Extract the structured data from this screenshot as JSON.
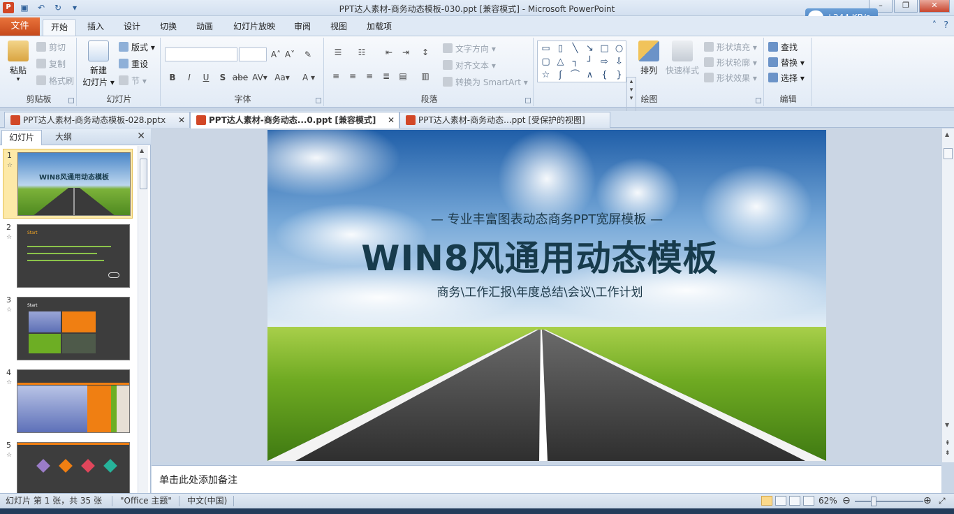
{
  "window": {
    "title": "PPT达人素材-商务动态模板-030.ppt [兼容模式]  -  Microsoft PowerPoint",
    "app_icon": "P"
  },
  "speed_widget": {
    "text": "↓244 KB/s"
  },
  "ribbon_tabs": [
    "文件",
    "开始",
    "插入",
    "设计",
    "切换",
    "动画",
    "幻灯片放映",
    "审阅",
    "视图",
    "加载项"
  ],
  "ribbon": {
    "clipboard": {
      "paste": "粘贴",
      "cut": "剪切",
      "copy": "复制",
      "format_painter": "格式刷",
      "label": "剪贴板"
    },
    "slides": {
      "new_slide_line1": "新建",
      "new_slide_line2": "幻灯片 ▾",
      "layout": "版式 ▾",
      "reset": "重设",
      "section": "节 ▾",
      "label": "幻灯片"
    },
    "font": {
      "label": "字体",
      "bold": "B",
      "italic": "I",
      "underline": "U",
      "shadow": "S",
      "strike": "abe",
      "spacing": "AV▾",
      "case": "Aa▾",
      "color": "A ▾",
      "grow": "A˄",
      "shrink": "A˅"
    },
    "paragraph": {
      "label": "段落",
      "text_direction": "文字方向 ▾",
      "align_text": "对齐文本 ▾",
      "smartart": "转换为 SmartArt ▾"
    },
    "drawing": {
      "label": "绘图",
      "arrange": "排列",
      "quick_styles": "快速样式",
      "fill": "形状填充 ▾",
      "outline": "形状轮廓 ▾",
      "effects": "形状效果 ▾"
    },
    "editing": {
      "label": "编辑",
      "find": "查找",
      "replace": "替换 ▾",
      "select": "选择 ▾"
    }
  },
  "doc_tabs": [
    {
      "label": "PPT达人素材-商务动态模板-028.pptx",
      "active": false
    },
    {
      "label": "PPT达人素材-商务动态...0.ppt [兼容模式]",
      "active": true
    },
    {
      "label": "PPT达人素材-商务动态...ppt [受保护的视图]",
      "active": false
    }
  ],
  "left_pane": {
    "tabs": [
      "幻灯片",
      "大纲"
    ],
    "thumbs": [
      {
        "num": "1",
        "title": "WIN8风通用动态模板",
        "start": ""
      },
      {
        "num": "2",
        "title": "",
        "start": "Start"
      },
      {
        "num": "3",
        "title": "",
        "start": "Start"
      },
      {
        "num": "4",
        "title": "",
        "start": ""
      },
      {
        "num": "5",
        "title": "",
        "start": ""
      }
    ]
  },
  "slide": {
    "subtitle": "— 专业丰富图表动态商务PPT宽屏模板 —",
    "title": "WIN8风通用动态模板",
    "tagline": "商务\\工作汇报\\年度总结\\会议\\工作计划"
  },
  "notes": {
    "placeholder": "单击此处添加备注"
  },
  "status": {
    "slide_info": "幻灯片 第 1 张，共 35 张",
    "theme": "\"Office 主题\"",
    "language": "中文(中国)",
    "zoom": "62%"
  }
}
